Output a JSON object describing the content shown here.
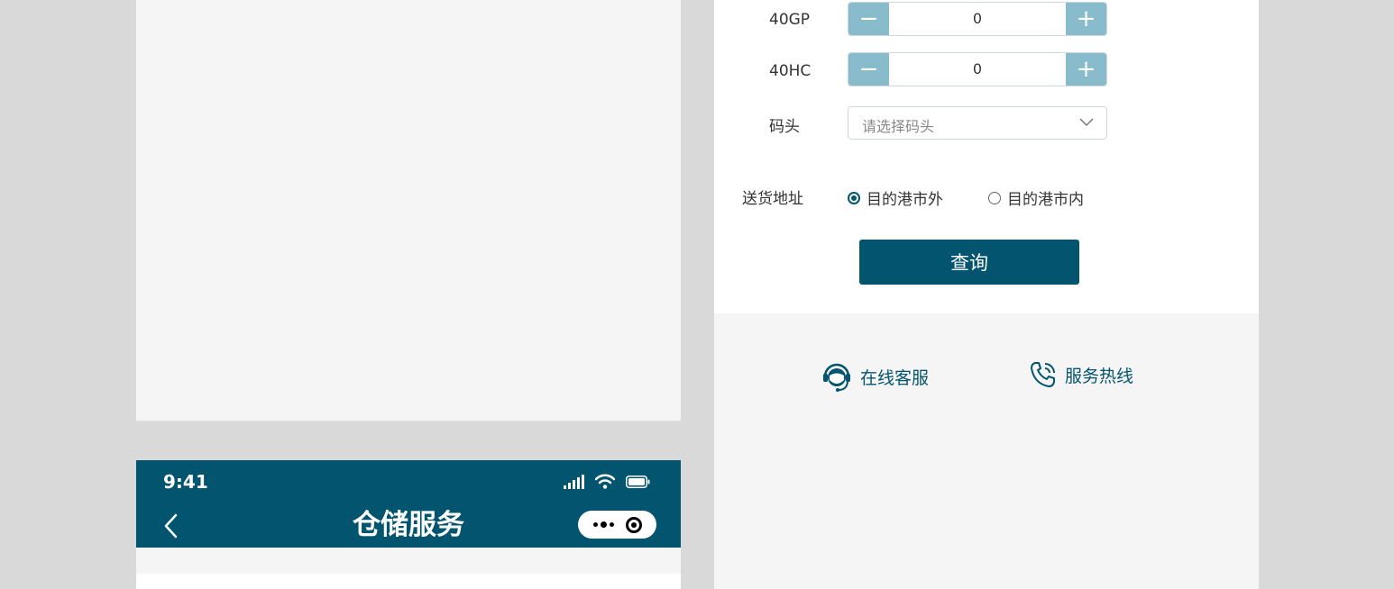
{
  "left_phone": {
    "status": {
      "time": "9:41"
    },
    "nav": {
      "title": "仓储服务"
    }
  },
  "form": {
    "rows": [
      {
        "label": "40GP",
        "value": "0",
        "minus": "−",
        "plus": "+"
      },
      {
        "label": "40HC",
        "value": "0",
        "minus": "−",
        "plus": "+"
      }
    ],
    "terminal": {
      "label": "码头",
      "placeholder": "请选择码头"
    },
    "delivery": {
      "label": "送货地址",
      "options": [
        {
          "label": "目的港市外",
          "selected": true
        },
        {
          "label": "目的港市内",
          "selected": false
        }
      ]
    },
    "submit_label": "查询"
  },
  "contact": {
    "online_service": "在线客服",
    "hotline": "服务热线"
  },
  "colors": {
    "primary": "#03546e",
    "stepper_button": "#88bccc",
    "panel_bg": "#f5f5f5",
    "page_bg": "#d9d9d9"
  }
}
